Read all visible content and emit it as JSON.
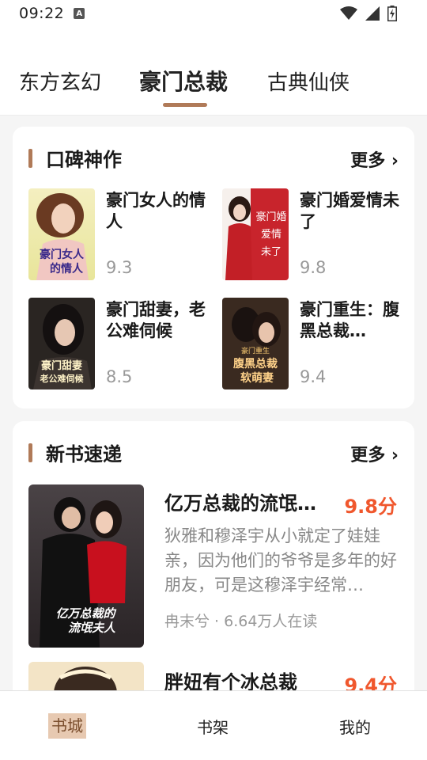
{
  "status": {
    "time": "09:22",
    "a_label": "A"
  },
  "tabs": [
    "东方玄幻",
    "豪门总裁",
    "古典仙侠"
  ],
  "section1": {
    "title": "口碑神作",
    "more": "更多 ›",
    "books": [
      {
        "title": "豪门女人的情人",
        "score": "9.3",
        "cover_text": "豪门女人的情人"
      },
      {
        "title": "豪门婚爱情未了",
        "score": "9.8",
        "cover_text": "豪门婚爱情未了"
      },
      {
        "title": "豪门甜妻，老公难伺候",
        "score": "8.5",
        "cover_text": "豪门甜妻老公难伺候"
      },
      {
        "title": "豪门重生：腹黑总裁…",
        "score": "9.4",
        "cover_text": "腹黑总裁软萌妻"
      }
    ]
  },
  "section2": {
    "title": "新书速递",
    "more": "更多 ›",
    "books": [
      {
        "title": "亿万总裁的流氓…",
        "score": "9.8分",
        "desc": "狄雅和穆泽宇从小就定了娃娃亲，因为他们的爷爷是多年的好朋友，可是这穆泽宇经常…",
        "meta": "冉末兮 · 6.64万人在读",
        "cover_text": "亿万总裁的流氓夫人"
      },
      {
        "title": "胖妞有个冰总裁",
        "score": "9.4分"
      }
    ]
  },
  "bottom_nav": [
    "书城",
    "书架",
    "我的"
  ]
}
